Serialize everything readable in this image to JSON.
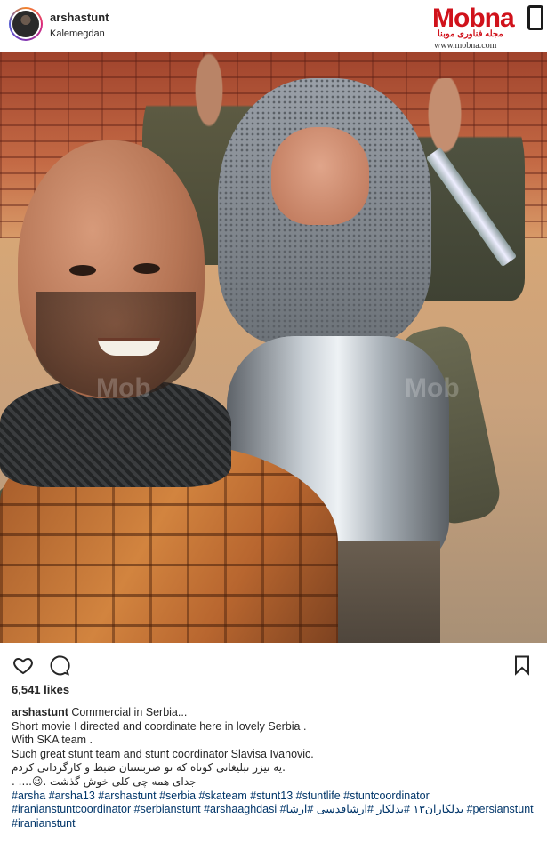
{
  "post": {
    "username": "arshastunt",
    "location": "Kalemegdan"
  },
  "logo": {
    "main": "Mobna",
    "sub": "مجله فناوری موبنا",
    "url": "www.mobna.com",
    "watermark": "Mob"
  },
  "icons": {
    "like": "heart-icon",
    "comment": "comment-icon",
    "save": "bookmark-icon"
  },
  "likes": "6,541 likes",
  "caption": {
    "username": "arshastunt",
    "first": "Commercial in Serbia...",
    "lines": [
      "Short movie I directed and coordinate here in lovely Serbia .",
      "With SKA team .",
      "Such great stunt team and stunt coordinator Slavisa Ivanovic.",
      ".یه تیزر تبلیغاتی کوتاه که تو صربستان ضبط و کارگردانی کردم",
      "جدای همه چی کلی خوش گذشت .😉.... ."
    ],
    "hashtags": "#arsha #arsha13 #arshastunt #serbia #skateam #stunt13 #stuntlife #stuntcoordinator #iranianstuntcoordinator #serbianstunt #arshaaghdasi #بدلکاران۱۳ #بدلکار #ارشاقدسی #ارشا #persianstunt #iranianstunt"
  }
}
